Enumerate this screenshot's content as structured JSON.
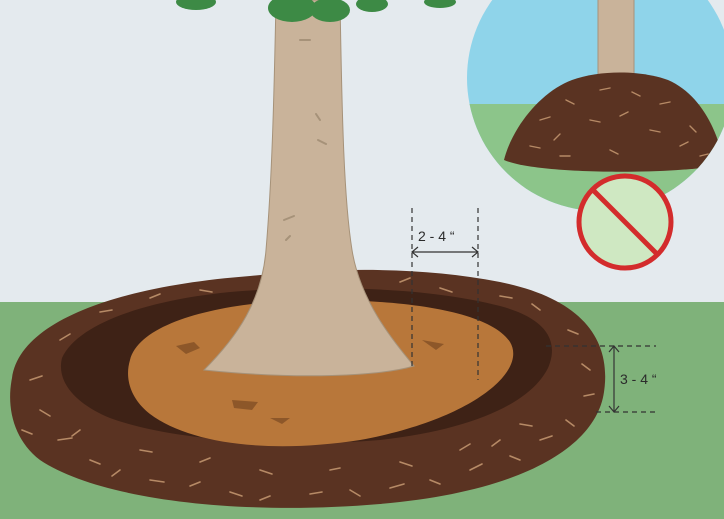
{
  "labels": {
    "trunk_gap": "2 - 4 “",
    "mulch_depth": "3 - 4 “"
  },
  "colors": {
    "sky": "#e4eaee",
    "grass": "#7fb27a",
    "mulch": "#5a3322",
    "mulch_dark": "#3e2216",
    "soil": "#b8773a",
    "trunk": "#c9b39a",
    "foliage": "#3d8a45",
    "inset_sky": "#8fd4ea",
    "inset_grass": "#8cc58a",
    "prohibited_sign": "#d32c2c"
  },
  "icons": {
    "prohibited": "no-symbol-icon"
  }
}
